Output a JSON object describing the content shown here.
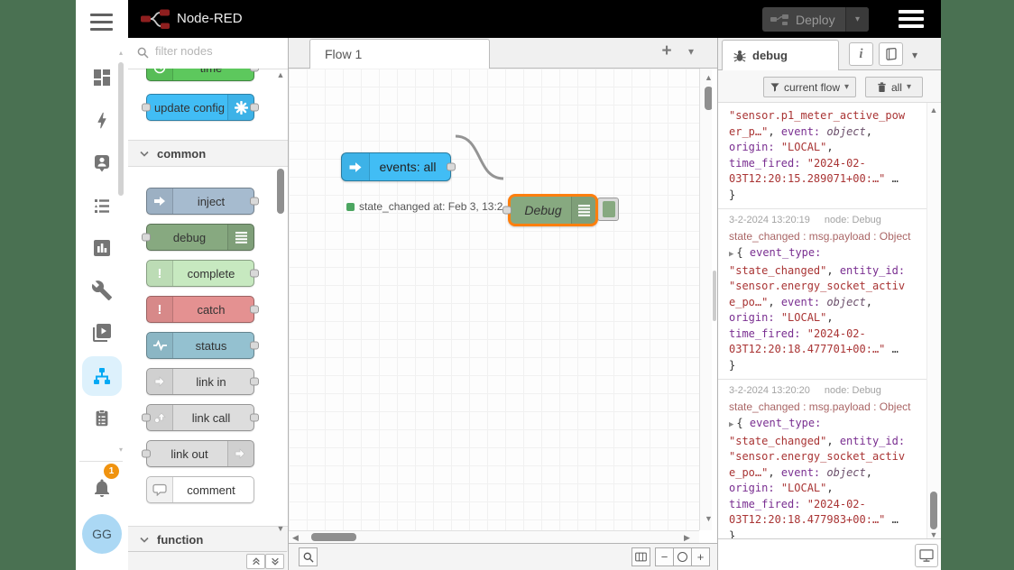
{
  "window": {
    "desktop_color": "#4a7152"
  },
  "glyphs": {
    "up": "▴",
    "down": "▾",
    "scroll_up": "▲",
    "scroll_down": "▼",
    "left": "◀",
    "right": "▶",
    "caret": "▾",
    "plus": "+",
    "minus": "−",
    "info": "i"
  },
  "ha_sidebar": {
    "notification_count": "1",
    "avatar_initials": "GG",
    "active_item": "node-red",
    "active_color": "#03a9f4",
    "icon_color": "#757575"
  },
  "header": {
    "title": "Node-RED",
    "deploy_label": "Deploy"
  },
  "palette": {
    "search_placeholder": "filter nodes",
    "scrolled_partial_node": {
      "label": "time",
      "color": "#5dc85d"
    },
    "update_config_node": {
      "label": "update config",
      "color": "#41bdf5"
    },
    "common_header": "common",
    "function_header": "function",
    "common_nodes": [
      {
        "label": "inject",
        "color": "#a6bbcf"
      },
      {
        "label": "debug",
        "color": "#87a980"
      },
      {
        "label": "complete",
        "color": "#c7e9c0"
      },
      {
        "label": "catch",
        "color": "#e49191"
      },
      {
        "label": "status",
        "color": "#94c1d0"
      },
      {
        "label": "link in",
        "color": "#dddddd"
      },
      {
        "label": "link call",
        "color": "#dddddd"
      },
      {
        "label": "link out",
        "color": "#dddddd"
      },
      {
        "label": "comment",
        "color": "#ffffff"
      }
    ]
  },
  "workspace": {
    "tab_label": "Flow 1",
    "nodes": {
      "events_all": {
        "label": "events: all",
        "color": "#41bdf5",
        "status_text": "state_changed at: Feb 3, 13:2",
        "status_color": "#4ca661"
      },
      "debug": {
        "label": "Debug",
        "color": "#87a980",
        "selected": true,
        "selection_color": "#ff7f0e"
      }
    }
  },
  "debug_panel": {
    "tab_label": "debug",
    "filter_label": "current flow",
    "clear_label": "all",
    "token_colors": {
      "key": "#792e90",
      "string": "#a93434",
      "meta": "#6b4f6b"
    },
    "messages": [
      {
        "partial": true,
        "lines": [
          [
            [
              "s",
              "\"sensor.p1_meter_active_pow"
            ]
          ],
          [
            [
              "s",
              "er_p…\""
            ],
            [
              "p",
              ", "
            ],
            [
              "k",
              "event:"
            ],
            [
              "p",
              " "
            ],
            [
              "m",
              "object"
            ],
            [
              "p",
              ","
            ]
          ],
          [
            [
              "k",
              "origin:"
            ],
            [
              "p",
              " "
            ],
            [
              "s",
              "\"LOCAL\""
            ],
            [
              "p",
              ","
            ]
          ],
          [
            [
              "k",
              "time_fired:"
            ],
            [
              "p",
              " "
            ],
            [
              "s",
              "\"2024-02-"
            ]
          ],
          [
            [
              "s",
              "03T12:20:15.289071+00:…\""
            ],
            [
              "p",
              " …"
            ]
          ],
          [
            [
              "p",
              "}"
            ]
          ]
        ]
      },
      {
        "time": "3-2-2024 13:20:19",
        "node": "node: Debug",
        "subject": "state_changed : msg.payload : Object",
        "lines": [
          [
            [
              "c",
              "▶"
            ],
            [
              "p",
              "{ "
            ],
            [
              "k",
              "event_type:"
            ]
          ],
          [
            [
              "s",
              "\"state_changed\""
            ],
            [
              "p",
              ", "
            ],
            [
              "k",
              "entity_id:"
            ]
          ],
          [
            [
              "s",
              "\"sensor.energy_socket_activ"
            ]
          ],
          [
            [
              "s",
              "e_po…\""
            ],
            [
              "p",
              ", "
            ],
            [
              "k",
              "event:"
            ],
            [
              "p",
              " "
            ],
            [
              "m",
              "object"
            ],
            [
              "p",
              ","
            ]
          ],
          [
            [
              "k",
              "origin:"
            ],
            [
              "p",
              " "
            ],
            [
              "s",
              "\"LOCAL\""
            ],
            [
              "p",
              ","
            ]
          ],
          [
            [
              "k",
              "time_fired:"
            ],
            [
              "p",
              " "
            ],
            [
              "s",
              "\"2024-02-"
            ]
          ],
          [
            [
              "s",
              "03T12:20:18.477701+00:…\""
            ],
            [
              "p",
              " …"
            ]
          ],
          [
            [
              "p",
              "}"
            ]
          ]
        ]
      },
      {
        "time": "3-2-2024 13:20:20",
        "node": "node: Debug",
        "subject": "state_changed : msg.payload : Object",
        "lines": [
          [
            [
              "c",
              "▶"
            ],
            [
              "p",
              "{ "
            ],
            [
              "k",
              "event_type:"
            ]
          ],
          [
            [
              "s",
              "\"state_changed\""
            ],
            [
              "p",
              ", "
            ],
            [
              "k",
              "entity_id:"
            ]
          ],
          [
            [
              "s",
              "\"sensor.energy_socket_activ"
            ]
          ],
          [
            [
              "s",
              "e_po…\""
            ],
            [
              "p",
              ", "
            ],
            [
              "k",
              "event:"
            ],
            [
              "p",
              " "
            ],
            [
              "m",
              "object"
            ],
            [
              "p",
              ","
            ]
          ],
          [
            [
              "k",
              "origin:"
            ],
            [
              "p",
              " "
            ],
            [
              "s",
              "\"LOCAL\""
            ],
            [
              "p",
              ","
            ]
          ],
          [
            [
              "k",
              "time_fired:"
            ],
            [
              "p",
              " "
            ],
            [
              "s",
              "\"2024-02-"
            ]
          ],
          [
            [
              "s",
              "03T12:20:18.477983+00:…\""
            ],
            [
              "p",
              " …"
            ]
          ],
          [
            [
              "p",
              "}"
            ]
          ]
        ]
      }
    ]
  }
}
